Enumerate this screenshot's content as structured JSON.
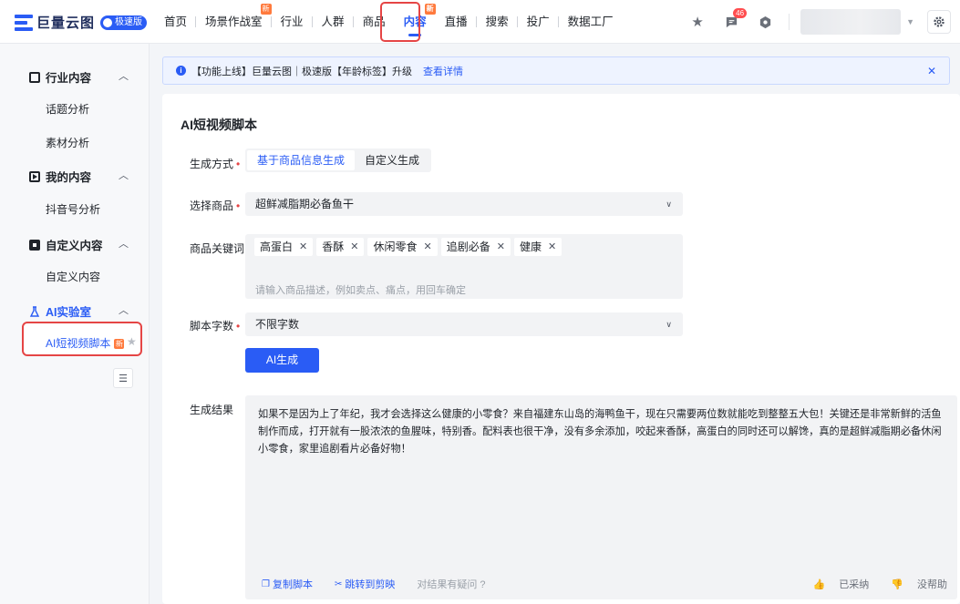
{
  "brand": {
    "name": "巨量云图",
    "edition_badge": "极速版"
  },
  "nav": {
    "items": [
      {
        "label": "首页",
        "new": ""
      },
      {
        "label": "场景作战室",
        "new": "新"
      },
      {
        "label": "行业",
        "new": ""
      },
      {
        "label": "人群",
        "new": ""
      },
      {
        "label": "商品",
        "new": ""
      },
      {
        "label": "内容",
        "new": "新"
      },
      {
        "label": "直播",
        "new": ""
      },
      {
        "label": "搜索",
        "new": ""
      },
      {
        "label": "投广",
        "new": ""
      },
      {
        "label": "数据工厂",
        "new": ""
      }
    ],
    "active": "内容",
    "message_count": "46"
  },
  "sidebar": {
    "groups": [
      {
        "label": "行业内容",
        "items": [
          "话题分析",
          "素材分析"
        ]
      },
      {
        "label": "我的内容",
        "items": [
          "抖音号分析"
        ]
      },
      {
        "label": "自定义内容",
        "items": [
          "自定义内容"
        ]
      },
      {
        "label": "AI实验室",
        "items": [
          "AI短视频脚本"
        ]
      }
    ],
    "active_item": "AI短视频脚本",
    "new_badge": "新"
  },
  "notice": {
    "text": "【功能上线】巨量云图｜极速版【年龄标签】升级",
    "link": "查看详情"
  },
  "form": {
    "title": "AI短视频脚本",
    "mode_label": "生成方式",
    "mode_options": [
      "基于商品信息生成",
      "自定义生成"
    ],
    "mode_selected": "基于商品信息生成",
    "product_label": "选择商品",
    "product_value": "超鲜减脂期必备鱼干",
    "keywords_label": "商品关键词",
    "keywords": [
      "高蛋白",
      "香酥",
      "休闲零食",
      "追剧必备",
      "健康"
    ],
    "keywords_placeholder": "请输入商品描述，例如卖点、痛点，用回车确定",
    "wordcount_label": "脚本字数",
    "wordcount_value": "不限字数",
    "generate_button": "AI生成",
    "result_label": "生成结果",
    "result_text": "如果不是因为上了年纪，我才会选择这么健康的小零食？来自福建东山岛的海鸭鱼干，现在只需要两位数就能吃到整整五大包！关键还是非常新鲜的活鱼制作而成，打开就有一股浓浓的鱼腥味，特别香。配料表也很干净，没有多余添加，咬起来香酥，高蛋白的同时还可以解馋，真的是超鲜减脂期必备休闲小零食，家里追剧看片必备好物！",
    "copy_button": "复制脚本",
    "jump_button": "跳转到剪映",
    "feedback_question": "对结果有疑问",
    "adopted": "已采纳",
    "not_helpful": "没帮助"
  },
  "colors": {
    "accent": "#2a5cf5",
    "highlight": "#e54545",
    "new_badge": "#ff7a3d"
  }
}
